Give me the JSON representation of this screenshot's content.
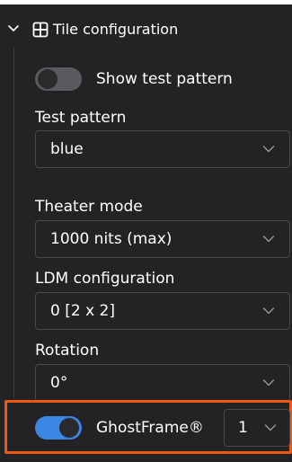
{
  "section": {
    "title": "Tile configuration",
    "collapse_icon": "chevron-down-icon",
    "icon": "grid-icon"
  },
  "test_pattern_toggle": {
    "label": "Show test pattern",
    "state": "off"
  },
  "test_pattern": {
    "label": "Test pattern",
    "value": "blue"
  },
  "theater_mode": {
    "label": "Theater mode",
    "value": "1000 nits (max)"
  },
  "ldm_configuration": {
    "label": "LDM configuration",
    "value": "0 [2 x 2]"
  },
  "rotation": {
    "label": "Rotation",
    "value": "0°"
  },
  "ghostframe": {
    "label": "GhostFrame®",
    "state": "on",
    "value": "1"
  },
  "colors": {
    "panel_background": "#232325",
    "toggle_on": "#3c86e4",
    "toggle_off": "#5b5b5f",
    "highlight": "#f2570f",
    "field_border": "#4a4a4e"
  }
}
